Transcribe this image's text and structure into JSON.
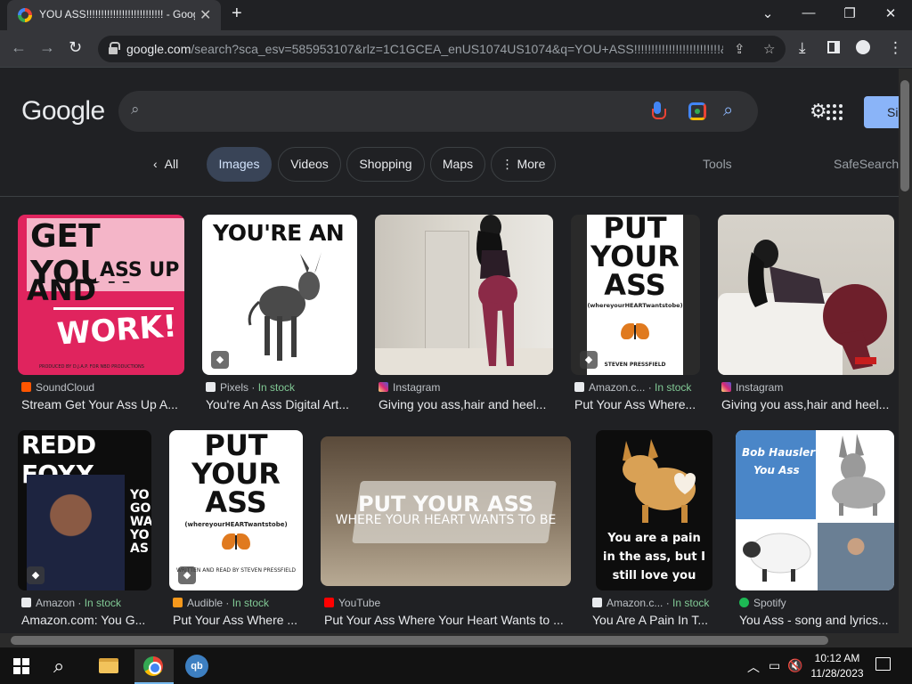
{
  "browser": {
    "tab_title": "YOU ASS!!!!!!!!!!!!!!!!!!!!!!!!!! - Google Search",
    "tab_close": "✕",
    "new_tab": "+",
    "url_domain": "google.com",
    "url_path": "/search?sca_esv=585953107&rlz=1C1GCEA_enUS1074US1074&q=YOU+ASS!!!!!!!!!!!!!!!!!!!!!!!!!&t...",
    "window_controls": [
      "⌄",
      "—",
      "❐",
      "✕"
    ]
  },
  "google": {
    "logo": "Google",
    "search_value": "",
    "signin_label": "Si",
    "chips": [
      {
        "label": "All",
        "active": false
      },
      {
        "label": "Images",
        "active": true
      },
      {
        "label": "Videos",
        "active": false
      },
      {
        "label": "Shopping",
        "active": false
      },
      {
        "label": "Maps",
        "active": false
      },
      {
        "label": "⋮ More",
        "active": false
      }
    ],
    "tools_label": "Tools",
    "safesearch_label": "SafeSearch"
  },
  "results": [
    {
      "source": "SoundCloud",
      "stock": "",
      "title": "Stream Get Your Ass Up A...",
      "icon_color": "#ff5500"
    },
    {
      "source": "Pixels",
      "stock": "In stock",
      "title": "You're An Ass Digital Art...",
      "icon_color": "#e8eaed"
    },
    {
      "source": "Instagram",
      "stock": "",
      "title": "Giving you ass,hair and heel...",
      "icon_color": "#c13584"
    },
    {
      "source": "Amazon.c...",
      "stock": "In stock",
      "title": "Put Your Ass Where...",
      "icon_color": "#e8eaed"
    },
    {
      "source": "Instagram",
      "stock": "",
      "title": "Giving you ass,hair and heel...",
      "icon_color": "#c13584"
    },
    {
      "source": "Amazon",
      "stock": "In stock",
      "title": "Amazon.com: You G...",
      "icon_color": "#e8eaed"
    },
    {
      "source": "Audible",
      "stock": "In stock",
      "title": "Put Your Ass Where ...",
      "icon_color": "#f7991c"
    },
    {
      "source": "YouTube",
      "stock": "",
      "title": "Put Your Ass Where Your Heart Wants to ...",
      "icon_color": "#ff0000"
    },
    {
      "source": "Amazon.c...",
      "stock": "In stock",
      "title": "You Are A Pain In T...",
      "icon_color": "#e8eaed"
    },
    {
      "source": "Spotify",
      "stock": "",
      "title": "You Ass - song and lyrics...",
      "icon_color": "#1db954"
    }
  ],
  "image_text": {
    "r1_1_line1": "GET YOUR",
    "r1_1_line2": "ASS UP",
    "r1_1_line3": "AND",
    "r1_1_line4": "WORK!",
    "r1_1_credit": "PRODUCED BY D.J.A.P. FOR NBD PRODUCTIONS",
    "r1_2_line1": "YOU'RE AN",
    "r1_4_line1": "PUT",
    "r1_4_line2": "YOUR",
    "r1_4_line3": "ASS",
    "r1_4_line4": "(whereyourHEARTwantstobe)",
    "r1_4_author": "STEVEN PRESSFIELD",
    "r2_1_line1": "REDD FOXX",
    "r2_1_side": "YO GO WA YO AS",
    "r2_2_line1": "PUT",
    "r2_2_line2": "YOUR",
    "r2_2_line3": "ASS",
    "r2_2_line4": "(whereyourHEARTwantstobe)",
    "r2_2_author": "WRITTEN AND READ BY STEVEN PRESSFIELD",
    "r2_3_line1": "PUT YOUR ASS",
    "r2_3_line2": "WHERE YOUR HEART WANTS TO BE",
    "r2_4_line1": "You are a pain",
    "r2_4_line2": "in the ass, but I",
    "r2_4_line3": "still love you",
    "r2_5_line1": "Bob Hausler",
    "r2_5_line2": "You Ass"
  },
  "taskbar": {
    "time": "10:12 AM",
    "date": "11/28/2023",
    "qb_label": "qb"
  }
}
